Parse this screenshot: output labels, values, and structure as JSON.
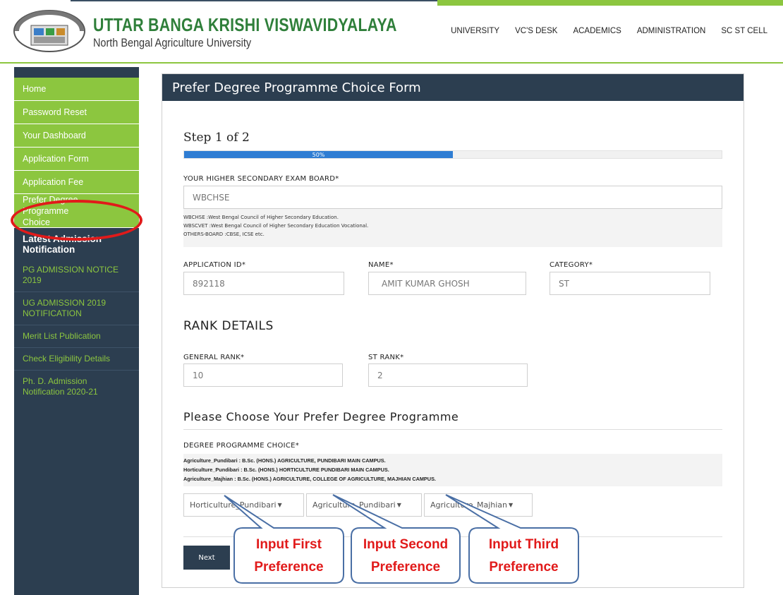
{
  "header": {
    "title": "UTTAR BANGA KRISHI VISWAVIDYALAYA",
    "subtitle": "North Bengal Agriculture University",
    "nav": [
      "UNIVERSITY",
      "VC'S DESK",
      "ACADEMICS",
      "ADMINISTRATION",
      "SC ST CELL"
    ]
  },
  "sidebar": {
    "items": [
      "Home",
      "Password Reset",
      "Your Dashboard",
      "Application Form",
      "Application Fee",
      "Prefer Degree Programme Choice"
    ],
    "heading": "Latest Admission Notification",
    "links": [
      "PG ADMISSION NOTICE 2019",
      "UG ADMISSION 2019 NOTIFICATION",
      "Merit List Publication",
      "Check Eligibility Details",
      "Ph. D. Admission Notification 2020-21"
    ]
  },
  "form": {
    "title": "Prefer Degree Programme Choice Form",
    "step": "Step 1 of 2",
    "progress_percent": 50,
    "progress_label": "50%",
    "board_label": "YOUR HIGHER SECONDARY EXAM BOARD*",
    "board_value": "WBCHSE",
    "board_help": [
      "WBCHSE :West Bengal Council of Higher Secondary Education.",
      "WBSCVET :West Bengal Council of Higher Secondary Education Vocational.",
      "OTHERS-BOARD :CBSE, ICSE etc."
    ],
    "application_id_label": "APPLICATION ID*",
    "application_id": "892118",
    "name_label": "NAME*",
    "name": "AMIT KUMAR GHOSH",
    "category_label": "CATEGORY*",
    "category": "ST",
    "rank_heading": "RANK DETAILS",
    "general_rank_label": "GENERAL RANK*",
    "general_rank": "10",
    "st_rank_label": "ST RANK*",
    "st_rank": "2",
    "choose_heading": "Please Choose Your Prefer Degree Programme",
    "choice_label": "DEGREE PROGRAMME CHOICE*",
    "choice_info": [
      "Agriculture_Pundibari : B.Sc. (HONS.) AGRICULTURE, PUNDIBARI MAIN CAMPUS.",
      "Horticulture_Pundibari : B.Sc. (HONS.) HORTICULTURE PUNDIBARI MAIN CAMPUS.",
      "Agriculture_Majhian : B.Sc. (HONS.) AGRICULTURE, COLLEGE OF AGRICULTURE, MAJHIAN CAMPUS."
    ],
    "choice1": "Horticulture_Pundibari",
    "choice2": "Agriculture_Pundibari",
    "choice3": "Agriculture_Majhian",
    "next_label": "Next"
  },
  "callouts": {
    "first": [
      "Input First",
      "Preference"
    ],
    "second": [
      "Input Second",
      "Preference"
    ],
    "third": [
      "Input Third",
      "Preference"
    ]
  },
  "colors": {
    "brand_green": "#8cc63f",
    "dark_navy": "#2c3e50",
    "progress_blue": "#2f7dd3",
    "annotation_red": "#e11a1a",
    "callout_border": "#4a6fa5"
  }
}
